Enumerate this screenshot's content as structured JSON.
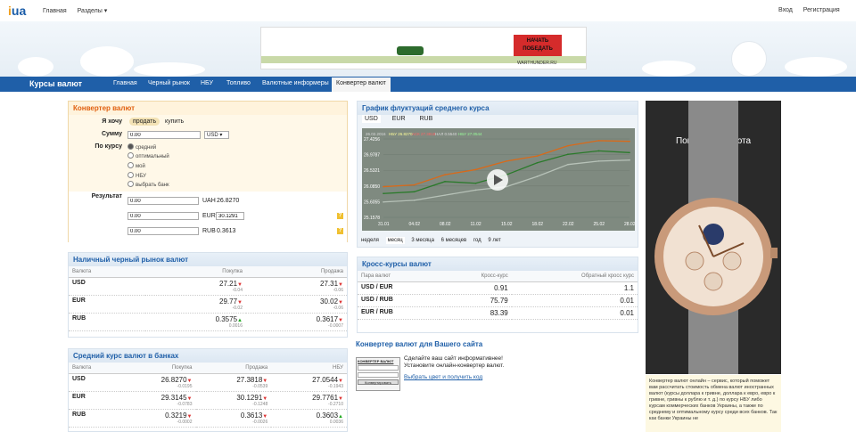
{
  "header": {
    "logo_prefix": "i",
    "logo_suffix": "ua",
    "nav": [
      "Главная",
      "Разделы ▾"
    ],
    "login": "Вход",
    "register": "Регистрация"
  },
  "ad": {
    "sign": "НАЧАТЬ ПОБЕДАТЬ",
    "url": "WARTHUNDER.RU"
  },
  "navbar": {
    "title": "Курсы валют",
    "items": [
      "Главная",
      "Черный рынок",
      "НБУ",
      "Топливо",
      "Валютные информеры",
      "Конвертер валют"
    ]
  },
  "converter": {
    "title": "Конвертер валют",
    "want_label": "Я хочу",
    "sell": "продать",
    "buy": "купить",
    "sum_label": "Сумму",
    "sum_value": "0.00",
    "currency": "USD ▾",
    "rate_label": "По курсу",
    "rate_options": [
      "средний",
      "оптимальный",
      "мой",
      "НБУ",
      "выбрать банк"
    ],
    "result_label": "Результат",
    "results": [
      {
        "value": "0.00",
        "cur": "UAH",
        "rate": "26.8270"
      },
      {
        "value": "0.00",
        "cur": "EUR",
        "rate": "30.1291"
      },
      {
        "value": "0.00",
        "cur": "RUB",
        "rate": "0.3613"
      }
    ],
    "help": "?"
  },
  "black": {
    "title": "Наличный черный рынок валют",
    "cols": [
      "Валюта",
      "Покупка",
      "Продажа"
    ],
    "rows": [
      {
        "cur": "USD",
        "buy": "27.21",
        "buy_d": "-0.04",
        "sell": "27.31",
        "sell_d": "-0.06",
        "buy_arrow": "▼",
        "sell_arrow": "▼"
      },
      {
        "cur": "EUR",
        "buy": "29.77",
        "buy_d": "-0.02",
        "sell": "30.02",
        "sell_d": "-0.06",
        "buy_arrow": "▼",
        "sell_arrow": "▼"
      },
      {
        "cur": "RUB",
        "buy": "0.3575",
        "buy_d": "0.0016",
        "sell": "0.3617",
        "sell_d": "-0.0007",
        "buy_arrow": "▲",
        "sell_arrow": "▼"
      }
    ]
  },
  "bank": {
    "title": "Средний курс валют в банках",
    "cols": [
      "Валюта",
      "Покупка",
      "Продажа",
      "НБУ"
    ],
    "rows": [
      {
        "cur": "USD",
        "buy": "26.8270",
        "buy_d": "-0.0195",
        "sell": "27.3818",
        "sell_d": "-0.0539",
        "nbu": "27.0544",
        "nbu_d": "-0.1943",
        "a1": "▼",
        "a2": "▼",
        "a3": "▼"
      },
      {
        "cur": "EUR",
        "buy": "29.3145",
        "buy_d": "-0.0783",
        "sell": "30.1291",
        "sell_d": "-0.1248",
        "nbu": "29.7761",
        "nbu_d": "-0.2710",
        "a1": "▼",
        "a2": "▼",
        "a3": "▼"
      },
      {
        "cur": "RUB",
        "buy": "0.3219",
        "buy_d": "-0.0002",
        "sell": "0.3613",
        "sell_d": "-0.0026",
        "nbu": "0.3603",
        "nbu_d": "0.0036",
        "a1": "▼",
        "a2": "▼",
        "a3": "▲"
      }
    ]
  },
  "chart": {
    "title": "График флуктуаций среднего курса",
    "tabs": [
      "USD",
      "EUR",
      "RUB"
    ],
    "legend": [
      "26.02.2016",
      "НБУ 26.8270",
      "АСК 27.3818",
      "НАЛ 0.5540",
      "НБУ 27.0544"
    ],
    "periods": [
      "неделя",
      "месяц",
      "3 месяца",
      "6 месяцев",
      "год",
      "9 лет"
    ]
  },
  "chart_data": {
    "type": "line",
    "x": [
      "31.01",
      "04.02",
      "08.02",
      "11.02",
      "15.02",
      "18.02",
      "22.02",
      "25.02",
      "28.02"
    ],
    "series": [
      {
        "values": [
          26.05,
          26.1,
          26.4,
          26.55,
          26.8,
          26.95,
          27.25,
          27.4,
          27.38
        ]
      },
      {
        "values": [
          25.85,
          25.9,
          26.2,
          26.15,
          26.4,
          26.75,
          27.0,
          27.1,
          27.05
        ]
      },
      {
        "values": [
          25.6,
          25.65,
          25.8,
          25.95,
          26.05,
          26.35,
          26.7,
          26.8,
          26.83
        ]
      }
    ],
    "yticks": [
      "27.4256",
      "26.9787",
      "26.5321",
      "26.0850",
      "25.6055",
      "25.1578"
    ],
    "colors": [
      "#d86a1a",
      "#2a7a2a",
      "#b7c2b8"
    ]
  },
  "cross": {
    "title": "Кросс-курсы валют",
    "cols": [
      "Пара валют",
      "Кросс-курс",
      "Обратный кросс курс"
    ],
    "rows": [
      {
        "pair": "USD / EUR",
        "rate": "0.91",
        "rev": "1.1"
      },
      {
        "pair": "USD / RUB",
        "rate": "75.79",
        "rev": "0.01"
      },
      {
        "pair": "EUR / RUB",
        "rate": "83.39",
        "rev": "0.01"
      }
    ]
  },
  "widget": {
    "title": "Конвертер валют для Вашего сайта",
    "text": "Сделайте ваш сайт информативнее! Установите онлайн-конвертер валют.",
    "link": "Выбрать цвет и получить код",
    "mini_title": "КОНВЕРТЕР ВАЛЮТ",
    "mini_btn": "Конвертировать"
  },
  "watch": {
    "caption": "Покриття з золота"
  },
  "about": {
    "text": "Конвертер валют онлайн – сервис, который поможет вам рассчитать стоимость обмена валют иностранных валют (курсы доллара к гривне, доллара к евро, евро к гривне, гривны к рублю и т. д.) по курсу НБУ либо курсам коммерческих банков Украины, а также по среднему и оптимальному курсу среди всех банков. Так как банки Украины не"
  }
}
